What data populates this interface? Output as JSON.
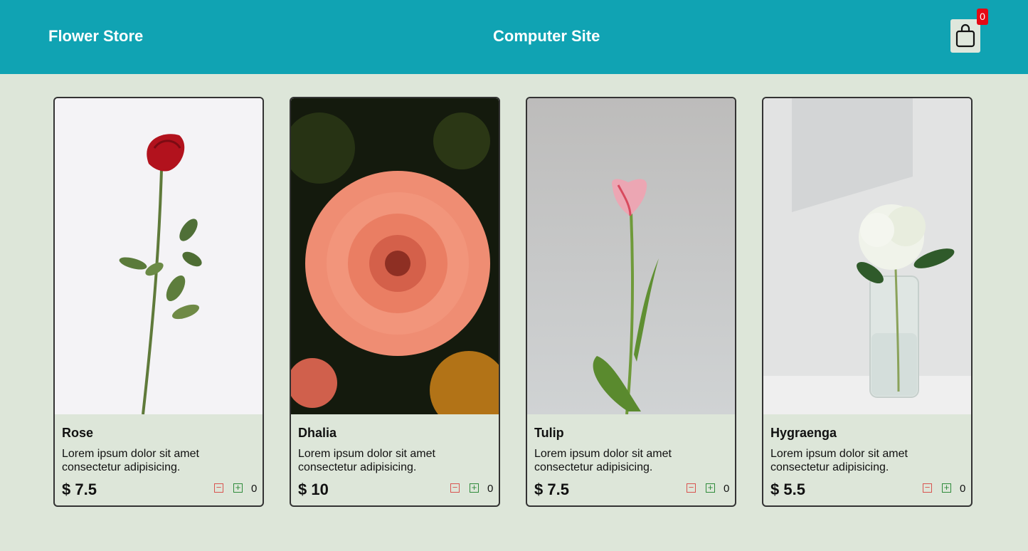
{
  "header": {
    "brand": "Flower Store",
    "site_title": "Computer Site",
    "cart_icon": "shopping-bag-icon",
    "cart_count": "0",
    "background_color": "#10a3b3",
    "badge_color": "#e50914"
  },
  "page": {
    "background_color": "#dde6d9"
  },
  "products": [
    {
      "name": "Rose",
      "description": "Lorem ipsum dolor sit amet consectetur adipisicing.",
      "price": "$ 7.5",
      "quantity": "0",
      "minus_label": "−",
      "plus_label": "+"
    },
    {
      "name": "Dhalia",
      "description": "Lorem ipsum dolor sit amet consectetur adipisicing.",
      "price": "$ 10",
      "quantity": "0",
      "minus_label": "−",
      "plus_label": "+"
    },
    {
      "name": "Tulip",
      "description": "Lorem ipsum dolor sit amet consectetur adipisicing.",
      "price": "$ 7.5",
      "quantity": "0",
      "minus_label": "−",
      "plus_label": "+"
    },
    {
      "name": "Hygraenga",
      "description": "Lorem ipsum dolor sit amet consectetur adipisicing.",
      "price": "$ 5.5",
      "quantity": "0",
      "minus_label": "−",
      "plus_label": "+"
    }
  ]
}
